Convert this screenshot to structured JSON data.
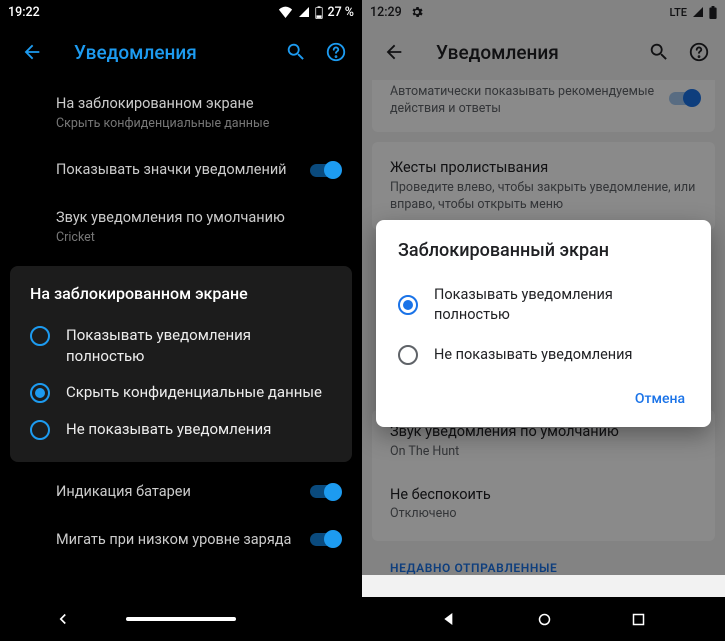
{
  "left": {
    "status": {
      "time": "19:22",
      "battery": "27 %"
    },
    "header": {
      "title": "Уведомления"
    },
    "items": {
      "lock_title": "На заблокированном экране",
      "lock_sub": "Скрыть конфиденциальные данные",
      "badges_title": "Показывать значки уведомлений",
      "sound_title": "Звук уведомления по умолчанию",
      "sound_sub": "Cricket",
      "battery_ind_title": "Индикация батареи",
      "blink_title": "Мигать при низком уровне заряда"
    },
    "dialog": {
      "title": "На заблокированном экране",
      "opt1": "Показывать уведомления полностью",
      "opt2": "Скрыть конфиденциальные данные",
      "opt3": "Не показывать уведомления",
      "selected": 2
    }
  },
  "right": {
    "status": {
      "time": "12:29",
      "net": "LTE"
    },
    "header": {
      "title": "Уведомления"
    },
    "top_item": {
      "sub": "Автоматически показывать рекомендуемые действия и ответы"
    },
    "swipe_card": {
      "title": "Жесты пролистывания",
      "sub": "Проведите  влево, чтобы закрыть уведомление, или вправо, чтобы открыть меню"
    },
    "dialog": {
      "title": "Заблокированный экран",
      "opt1": "Показывать уведомления полностью",
      "opt2": "Не показывать уведомления",
      "cancel": "Отмена",
      "selected": 1
    },
    "bottom_card": {
      "sound_title": "Звук уведомления по умолчанию",
      "sound_sub": "On The Hunt",
      "dnd_title": "Не беспокоить",
      "dnd_sub": "Отключено"
    },
    "recent": "НЕДАВНО ОТПРАВЛЕННЫЕ"
  }
}
